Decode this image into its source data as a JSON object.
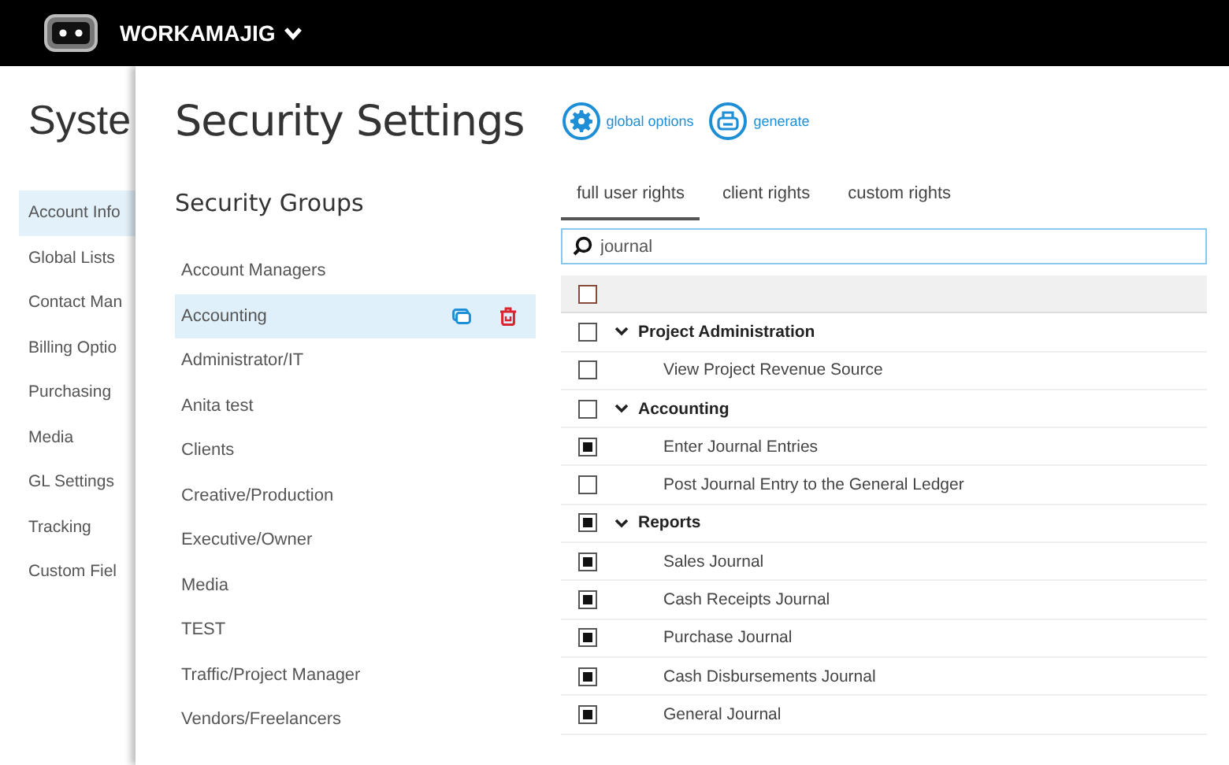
{
  "app": {
    "name": "WORKAMAJIG"
  },
  "background_page": {
    "title": "Syste",
    "nav": [
      {
        "label": "Account Info",
        "selected": true
      },
      {
        "label": "Global Lists",
        "selected": false
      },
      {
        "label": "Contact Man",
        "selected": false
      },
      {
        "label": "Billing Optio",
        "selected": false
      },
      {
        "label": "Purchasing",
        "selected": false
      },
      {
        "label": "Media",
        "selected": false
      },
      {
        "label": "GL Settings",
        "selected": false
      },
      {
        "label": "Tracking",
        "selected": false
      },
      {
        "label": "Custom Fiel",
        "selected": false
      }
    ]
  },
  "panel": {
    "title": "Security Settings",
    "actions": [
      {
        "kind": "gear",
        "label": "global options"
      },
      {
        "kind": "print",
        "label": "generate"
      }
    ],
    "groups_heading": "Security Groups",
    "groups": [
      {
        "label": "Account Managers",
        "selected": false
      },
      {
        "label": "Accounting",
        "selected": true
      },
      {
        "label": "Administrator/IT",
        "selected": false
      },
      {
        "label": "Anita test",
        "selected": false
      },
      {
        "label": "Clients",
        "selected": false
      },
      {
        "label": "Creative/Production",
        "selected": false
      },
      {
        "label": "Executive/Owner",
        "selected": false
      },
      {
        "label": "Media",
        "selected": false
      },
      {
        "label": "TEST",
        "selected": false
      },
      {
        "label": "Traffic/Project Manager",
        "selected": false
      },
      {
        "label": "Vendors/Freelancers",
        "selected": false
      }
    ],
    "tabs": [
      {
        "label": "full user rights",
        "selected": true
      },
      {
        "label": "client rights",
        "selected": false
      },
      {
        "label": "custom rights",
        "selected": false
      }
    ],
    "search": {
      "value": "journal"
    },
    "rights": {
      "all_checked": false,
      "items": [
        {
          "label": "Project Administration",
          "checked": false,
          "expanded": true,
          "children": [
            {
              "label": "View Project Revenue Source",
              "checked": false
            }
          ]
        },
        {
          "label": "Accounting",
          "checked": false,
          "expanded": true,
          "children": [
            {
              "label": "Enter Journal Entries",
              "checked": true
            },
            {
              "label": "Post Journal Entry to the General Ledger",
              "checked": false
            }
          ]
        },
        {
          "label": "Reports",
          "checked": true,
          "expanded": true,
          "children": [
            {
              "label": "Sales Journal",
              "checked": true
            },
            {
              "label": "Cash Receipts Journal",
              "checked": true
            },
            {
              "label": "Purchase Journal",
              "checked": true
            },
            {
              "label": "Cash Disbursements Journal",
              "checked": true
            },
            {
              "label": "General Journal",
              "checked": true
            }
          ]
        }
      ]
    }
  }
}
